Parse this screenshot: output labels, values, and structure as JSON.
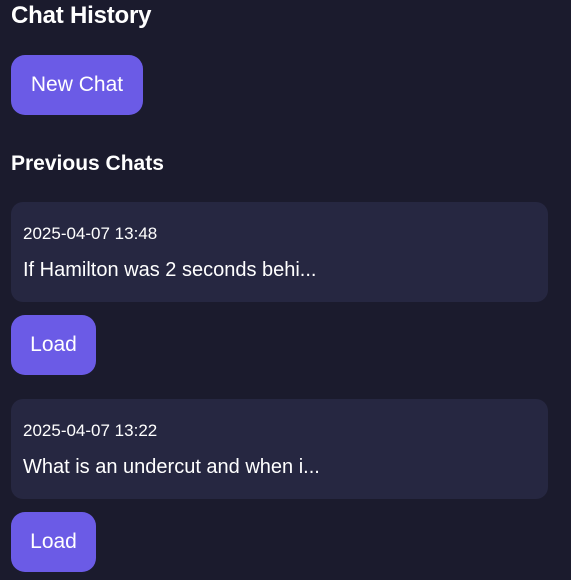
{
  "panel": {
    "title": "Chat History",
    "new_chat_label": "New Chat",
    "previous_chats_heading": "Previous Chats"
  },
  "chats": [
    {
      "timestamp": "2025-04-07 13:48",
      "preview": "If Hamilton was 2 seconds behi...",
      "load_label": "Load"
    },
    {
      "timestamp": "2025-04-07 13:22",
      "preview": "What is an undercut and when i...",
      "load_label": "Load"
    }
  ],
  "colors": {
    "background": "#1b1b2d",
    "card": "#262741",
    "accent": "#6b5be6",
    "text": "#ffffff"
  }
}
